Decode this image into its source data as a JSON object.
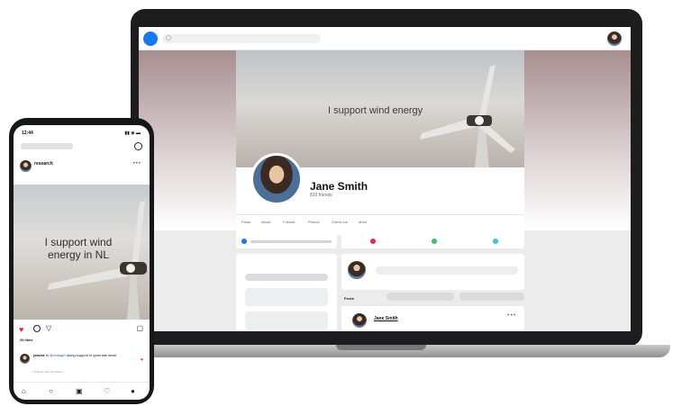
{
  "laptop": {
    "cover_text": "I support wind energy",
    "profile": {
      "name": "Jane Smith",
      "friends": "810 friends"
    },
    "tabs": [
      "Posts",
      "About",
      "Friends",
      "Photos",
      "Check-ins",
      "More"
    ],
    "post_card": {
      "posts_label": "Posts",
      "author": "Jane Smith"
    },
    "colors": {
      "brand_blue": "#1877f2",
      "video_icon": "#f0284a",
      "photo_icon": "#45bd62",
      "location_icon": "#3fc3dd"
    }
  },
  "phone": {
    "status_time": "12:44",
    "status_icons": "▮▮ ◉ ▬",
    "username": "research",
    "subline": "",
    "post_text": "I support wind energy in NL",
    "likes": "29 likes",
    "caption_user": "jsaved",
    "caption_mention": "@orangef",
    "caption_pre": " In ",
    "caption_post": " doing support in groenste sexel",
    "comment_actions": "1h   Reply   See Translation",
    "nav_icons": [
      "home-icon",
      "search-icon",
      "reels-icon",
      "heart-icon",
      "profile-icon"
    ]
  }
}
